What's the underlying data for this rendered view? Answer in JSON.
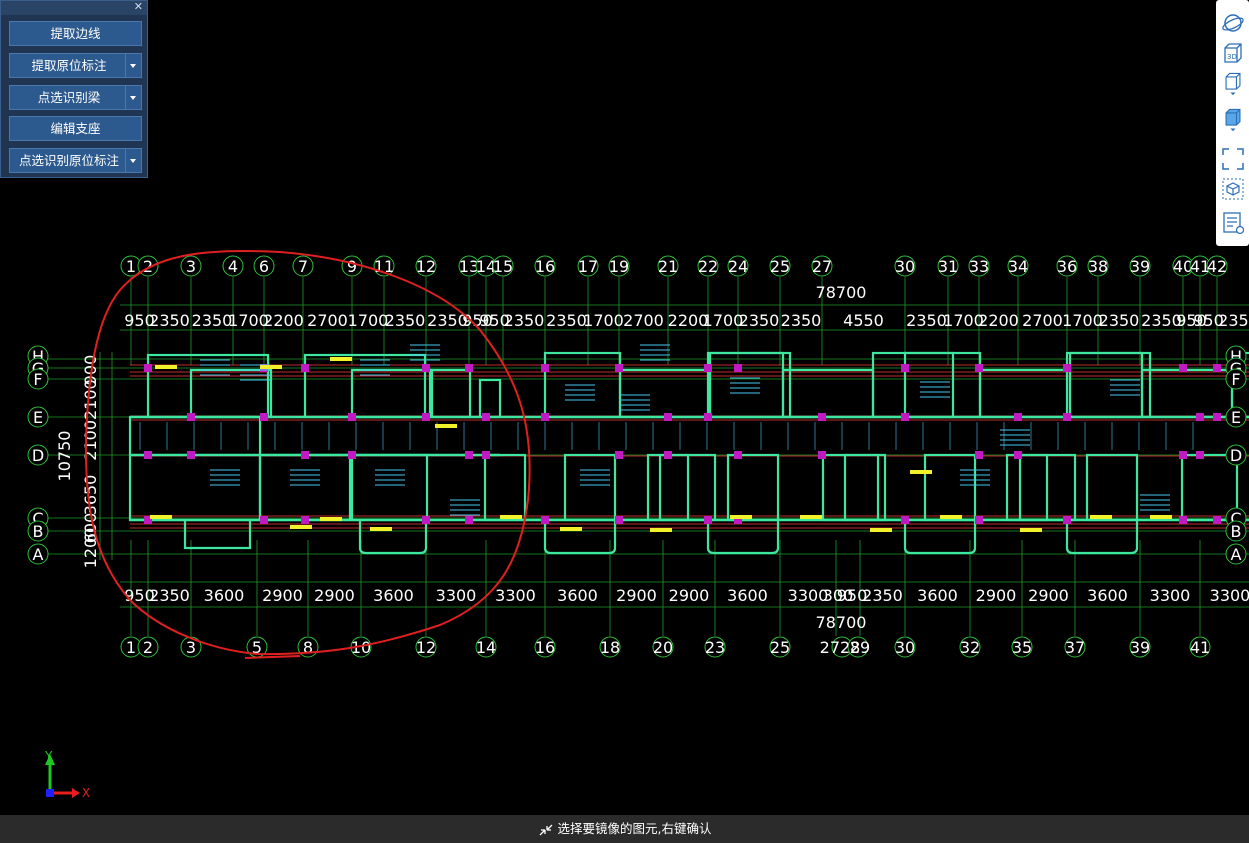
{
  "panel": {
    "close_icon": "close-icon",
    "buttons": [
      {
        "label": "提取边线",
        "dropdown": false
      },
      {
        "label": "提取原位标注",
        "dropdown": true
      },
      {
        "label": "点选识别梁",
        "dropdown": true
      },
      {
        "label": "编辑支座",
        "dropdown": false
      },
      {
        "label": "点选识别原位标注",
        "dropdown": true
      }
    ]
  },
  "toolbar": {
    "items": [
      "orbit-icon",
      "view-3d-icon",
      "view-cube-icon",
      "view-box-icon",
      "zoom-extents-icon",
      "display-settings-icon",
      "properties-list-icon"
    ],
    "label_3d": "3D"
  },
  "drawing": {
    "top_axis_numbers": [
      "1",
      "2",
      "3",
      "4",
      "6",
      "7",
      "9",
      "11",
      "12",
      "13",
      "14",
      "15",
      "16",
      "17",
      "19",
      "21",
      "22",
      "24",
      "25",
      "27",
      "30",
      "31",
      "33",
      "34",
      "36",
      "38",
      "39",
      "40",
      "41",
      "42"
    ],
    "top_total": "78700",
    "top_dims": [
      "950",
      "2350",
      "2350",
      "1700",
      "2200",
      "2700",
      "1700",
      "2350",
      "2350",
      "950",
      "950",
      "2350",
      "2350",
      "1700",
      "2700",
      "2200",
      "1700",
      "2350",
      "2350",
      "4550",
      "2350",
      "1700",
      "2200",
      "2700",
      "1700",
      "2350",
      "2350",
      "950",
      "950",
      "2350"
    ],
    "bottom_dims": [
      "950",
      "2350",
      "3600",
      "2900",
      "2900",
      "3600",
      "3300",
      "3300",
      "3600",
      "2900",
      "2900",
      "3600",
      "3300",
      "300",
      "950",
      "2350",
      "3600",
      "2900",
      "2900",
      "3600",
      "3300",
      "3300"
    ],
    "bottom_total": "78700",
    "bottom_axis_numbers": [
      "1",
      "2",
      "3",
      "5",
      "8",
      "10",
      "12",
      "14",
      "16",
      "18",
      "20",
      "23",
      "25",
      "28",
      "29",
      "30",
      "32",
      "35",
      "37",
      "39",
      "41"
    ],
    "bottom_merged_label": "2728",
    "row_axes": [
      "H",
      "G",
      "F",
      "E",
      "D",
      "C",
      "B",
      "A"
    ],
    "left_dims": [
      "10750",
      "2100",
      "2100",
      "900",
      "3650",
      "600",
      "1200"
    ],
    "ucs_x": "X",
    "ucs_y": "Y"
  },
  "status": {
    "message": "选择要镜像的图元,右键确认",
    "icon": "mirror-select-icon"
  },
  "colors": {
    "axis_circle": "#2fbf3a",
    "axis_text": "#ffffff",
    "dim_line": "#1f9a2a",
    "beam": "#3de7a0",
    "wall_edge": "#ff3a3a",
    "column": "#c21ac2",
    "annotation": "#49c9f0",
    "label_yellow": "#f2f22a",
    "markup": "#e02020",
    "panel_bg": "#1f3552",
    "button_bg": "#2d5a8e"
  }
}
